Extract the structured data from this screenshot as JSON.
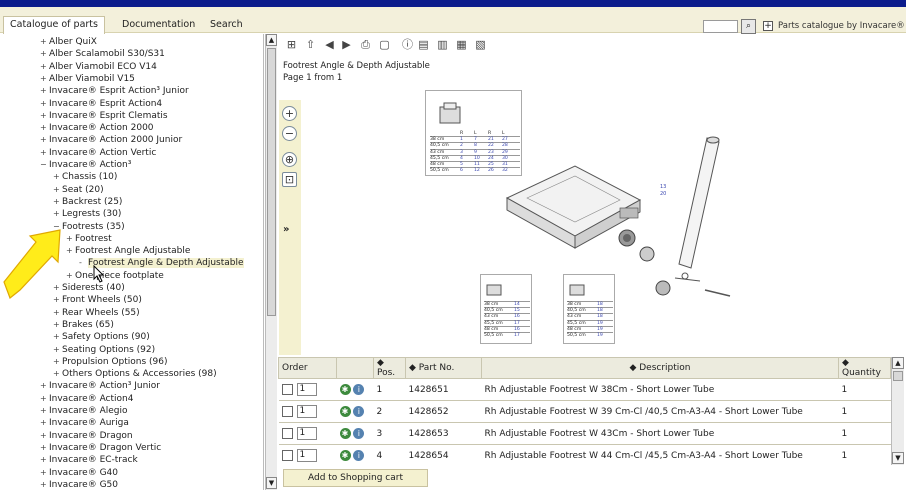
{
  "menu": {
    "catalogue": "Catalogue of parts",
    "documentation": "Documentation",
    "search": "Search",
    "brand": "Parts catalogue by Invacare®"
  },
  "icons": {
    "search": "magnifier-icon",
    "expand": "plus-box-icon"
  },
  "tree": [
    {
      "label": "Alber QuiX",
      "toggle": "+"
    },
    {
      "label": "Alber Scalamobil S30/S31",
      "toggle": "+"
    },
    {
      "label": "Alber Viamobil ECO V14",
      "toggle": "+"
    },
    {
      "label": "Alber Viamobil V15",
      "toggle": "+"
    },
    {
      "label": "Invacare® Esprit Action³ Junior",
      "toggle": "+"
    },
    {
      "label": "Invacare® Esprit Action4",
      "toggle": "+"
    },
    {
      "label": "Invacare® Esprit Clematis",
      "toggle": "+"
    },
    {
      "label": "Invacare® Action 2000",
      "toggle": "+"
    },
    {
      "label": "Invacare® Action 2000 Junior",
      "toggle": "+"
    },
    {
      "label": "Invacare® Action Vertic",
      "toggle": "+"
    },
    {
      "label": "Invacare® Action³",
      "toggle": "−"
    },
    {
      "label": "Chassis (10)",
      "toggle": "+"
    },
    {
      "label": "Seat (20)",
      "toggle": "+"
    },
    {
      "label": "Backrest (25)",
      "toggle": "+"
    },
    {
      "label": "Legrests (30)",
      "toggle": "+"
    },
    {
      "label": "Footrests (35)",
      "toggle": "−"
    },
    {
      "label": "Footrest",
      "toggle": "+"
    },
    {
      "label": "Footrest Angle Adjustable",
      "toggle": "+"
    },
    {
      "label": "Footrest Angle & Depth Adjustable",
      "toggle": "-"
    },
    {
      "label": "One piece footplate",
      "toggle": "+"
    },
    {
      "label": "Siderests (40)",
      "toggle": "+"
    },
    {
      "label": "Front Wheels (50)",
      "toggle": "+"
    },
    {
      "label": "Rear Wheels (55)",
      "toggle": "+"
    },
    {
      "label": "Brakes (65)",
      "toggle": "+"
    },
    {
      "label": "Safety Options (90)",
      "toggle": "+"
    },
    {
      "label": "Seating Options (92)",
      "toggle": "+"
    },
    {
      "label": "Propulsion Options (96)",
      "toggle": "+"
    },
    {
      "label": "Others Options & Accessories (98)",
      "toggle": "+"
    },
    {
      "label": "Invacare® Action³ Junior",
      "toggle": "+"
    },
    {
      "label": "Invacare® Action4",
      "toggle": "+"
    },
    {
      "label": "Invacare® Alegio",
      "toggle": "+"
    },
    {
      "label": "Invacare® Auriga",
      "toggle": "+"
    },
    {
      "label": "Invacare® Dragon",
      "toggle": "+"
    },
    {
      "label": "Invacare® Dragon Vertic",
      "toggle": "+"
    },
    {
      "label": "Invacare® EC-track",
      "toggle": "+"
    },
    {
      "label": "Invacare® G40",
      "toggle": "+"
    },
    {
      "label": "Invacare® G50",
      "toggle": "+"
    }
  ],
  "toolbar": {
    "icons": [
      "tree-toggle-icon",
      "home-icon",
      "back-icon",
      "forward-icon",
      "print-icon",
      "book-icon",
      "info-icon",
      "view-list-icon",
      "view-compact-icon",
      "view-split-icon",
      "view-grid-icon"
    ]
  },
  "document": {
    "title": "Footrest Angle & Depth Adjustable",
    "page": "Page 1 from 1"
  },
  "zoom": {
    "expand": "»"
  },
  "drawing": {
    "top_table": {
      "headers": [
        "R",
        "L",
        "R",
        "L"
      ],
      "rows": [
        [
          "38 cm",
          "1",
          "7",
          "21",
          "27"
        ],
        [
          "40,5 cm",
          "2",
          "8",
          "22",
          "28"
        ],
        [
          "43 cm",
          "3",
          "9",
          "23",
          "29"
        ],
        [
          "45,5 cm",
          "4",
          "10",
          "24",
          "30"
        ],
        [
          "48 cm",
          "5",
          "11",
          "25",
          "31"
        ],
        [
          "50,5 cm",
          "6",
          "12",
          "26",
          "32"
        ]
      ]
    },
    "left_table": {
      "rows": [
        [
          "38 cm",
          "14"
        ],
        [
          "40,5 cm",
          "15"
        ],
        [
          "43 cm",
          "16"
        ],
        [
          "45,5 cm",
          "17"
        ],
        [
          "48 cm",
          "16"
        ],
        [
          "50,5 cm",
          "17"
        ]
      ]
    },
    "right_table": {
      "rows": [
        [
          "38 cm",
          "18"
        ],
        [
          "40,5 cm",
          "18"
        ],
        [
          "43 cm",
          "18"
        ],
        [
          "45,5 cm",
          "19"
        ],
        [
          "48 cm",
          "19"
        ],
        [
          "50,5 cm",
          "19"
        ]
      ]
    },
    "callouts": [
      "13",
      "20"
    ]
  },
  "table": {
    "headers": {
      "order": "Order",
      "pos": "◆ Pos.",
      "part": "◆ Part No.",
      "description": "◆ Description",
      "quantity": "◆ Quantity"
    },
    "rows": [
      {
        "qty_input": "1",
        "pos": "1",
        "part": "1428651",
        "description": "Rh Adjustable Footrest W 38Cm - Short Lower Tube",
        "quantity": "1"
      },
      {
        "qty_input": "1",
        "pos": "2",
        "part": "1428652",
        "description": "Rh Adjustable Footrest W 39 Cm-Cl /40,5 Cm-A3-A4 - Short Lower Tube",
        "quantity": "1"
      },
      {
        "qty_input": "1",
        "pos": "3",
        "part": "1428653",
        "description": "Rh Adjustable Footrest W 43Cm - Short Lower Tube",
        "quantity": "1"
      },
      {
        "qty_input": "1",
        "pos": "4",
        "part": "1428654",
        "description": "Rh Adjustable Footrest W 44 Cm-Cl /45,5 Cm-A3-A4 - Short Lower Tube",
        "quantity": "1"
      }
    ]
  },
  "cart": {
    "label": "Add to Shopping cart"
  }
}
